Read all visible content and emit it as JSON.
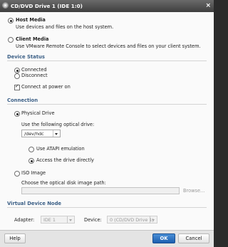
{
  "window": {
    "title": "CD/DVD Drive 1 (IDE 1:0)",
    "close_glyph": "×"
  },
  "media": {
    "host_label": "Host Media",
    "host_desc": "Use devices and files on the host system.",
    "client_label": "Client Media",
    "client_desc": "Use VMware Remote Console to select devices and files on your client system.",
    "selected": "host"
  },
  "device_status": {
    "heading": "Device Status",
    "connected_label": "Connected",
    "disconnect_label": "Disconnect",
    "connect_power_label": "Connect at power on",
    "selected": "connected",
    "connect_at_power_on": true
  },
  "connection": {
    "heading": "Connection",
    "physical_label": "Physical Drive",
    "optical_drive_label": "Use the following optical drive:",
    "optical_drive_value": "/dev/hdc",
    "atapi_label": "Use ATAPI emulation",
    "direct_label": "Access the drive directly",
    "iso_label": "ISO Image",
    "iso_path_label": "Choose the optical disk image path:",
    "iso_path_value": "",
    "browse_label": "Browse...",
    "selected": "physical",
    "access_mode": "direct"
  },
  "virtual_node": {
    "heading": "Virtual Device Node",
    "adapter_label": "Adapter:",
    "adapter_value": "IDE 1",
    "device_label": "Device:",
    "device_value": "0 (CD/DVD Drive 1)"
  },
  "footer": {
    "help_label": "Help",
    "ok_label": "OK",
    "cancel_label": "Cancel"
  }
}
